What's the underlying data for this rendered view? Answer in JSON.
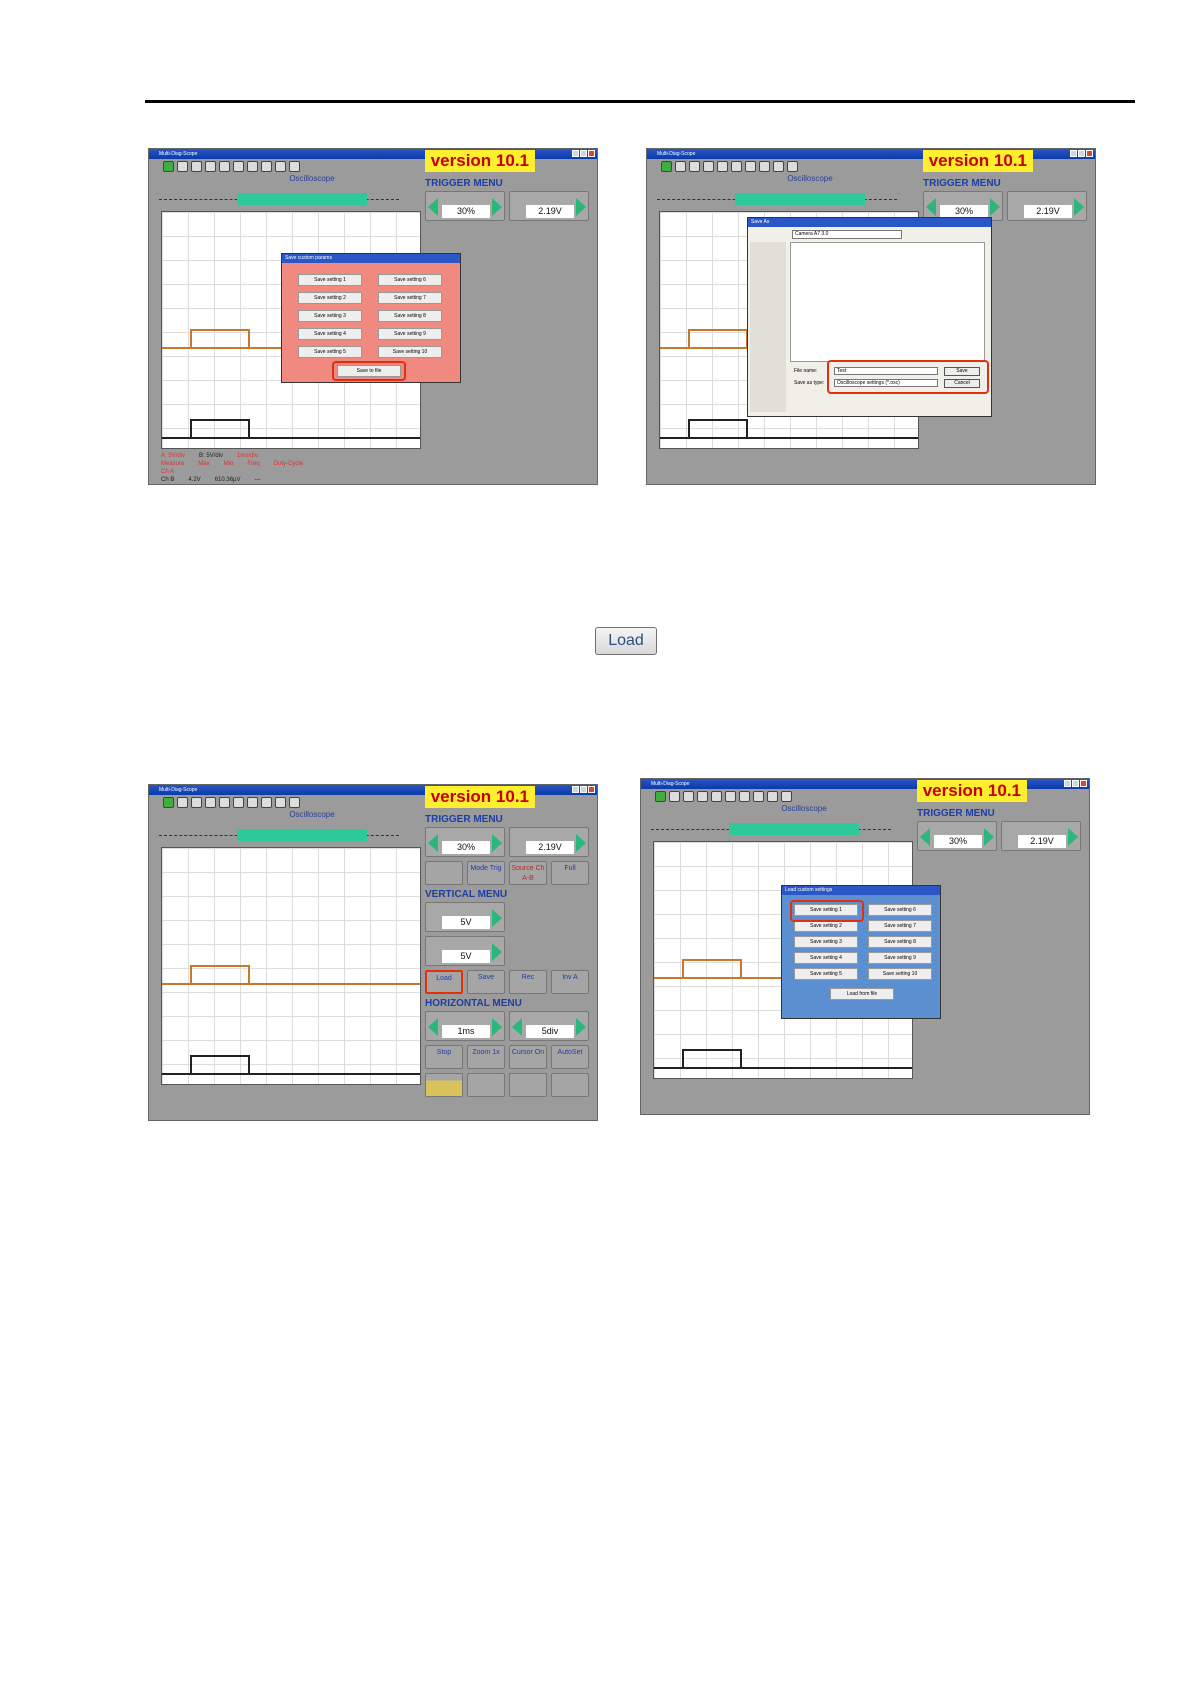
{
  "shots": [
    {
      "app_title": "Multi-Diag-Scope",
      "version": "version 10.1",
      "osc_title": "Oscilloscope",
      "trigger_menu": "TRIGGER MENU",
      "trigger_pos": "30%",
      "trigger_level": "2.19V",
      "dialog_title": "Save custom params",
      "settings_left": [
        "Save setting 1",
        "Save setting 2",
        "Save setting 3",
        "Save setting 4",
        "Save setting 5"
      ],
      "settings_right": [
        "Save setting 6",
        "Save setting 7",
        "Save setting 8",
        "Save setting 9",
        "Save setting 10"
      ],
      "action": "Save to file"
    },
    {
      "app_title": "Multi-Diag-Scope",
      "version": "version 10.1",
      "osc_title": "Oscilloscope",
      "trigger_menu": "TRIGGER MENU",
      "trigger_pos": "30%",
      "trigger_level": "2.19V",
      "dialog_title": "Save As",
      "save_in": "Camera A7 3.0",
      "file_name_label": "File name:",
      "file_name": "Test",
      "file_type_label": "Save as type:",
      "file_type": "Oscilloscope settings (*.osc)",
      "save_button": "Save",
      "cancel_button": "Cancel"
    },
    {
      "app_title": "Multi-Diag-Scope",
      "version": "version 10.1",
      "osc_title": "Oscilloscope",
      "trigger_menu": "TRIGGER MENU",
      "vertical_menu": "VERTICAL MENU",
      "horizontal_menu": "HORIZONTAL MENU",
      "trigger_pos": "30%",
      "trigger_level": "2.19V",
      "cha_scale": "5V",
      "chb_scale": "5V",
      "time_scale": "1ms",
      "window_pos": "5div",
      "load": "Load",
      "save": "Save",
      "rec": "Rec",
      "inv": "Inv A"
    },
    {
      "app_title": "Multi-Diag-Scope",
      "version": "version 10.1",
      "osc_title": "Oscilloscope",
      "trigger_menu": "TRIGGER MENU",
      "trigger_pos": "30%",
      "trigger_level": "2.19V",
      "dialog_title": "Load custom settings",
      "settings_left": [
        "Save setting 1",
        "Save setting 2",
        "Save setting 3",
        "Save setting 4",
        "Save setting 5"
      ],
      "settings_right": [
        "Save setting 6",
        "Save setting 7",
        "Save setting 8",
        "Save setting 9",
        "Save setting 10"
      ],
      "action": "Load from file"
    }
  ],
  "load_icon": "Load",
  "common": {
    "mode": "Mode Trig",
    "source": "Source Ch A-B",
    "full": "Full",
    "stop": "Stop",
    "zoom": "Zoom 1x",
    "cursor": "Cursor On",
    "autoset": "AutoSet",
    "ch_a_scale_label": "A: 5V/div",
    "ch_b_scale_label": "B: 5V/div",
    "time_label": "1ms/div",
    "measure_header": "Measure",
    "max_header": "Max",
    "min_header": "Min",
    "freq_header": "Freq",
    "duty_header": "Duty-Cycle",
    "ch_a": "Ch A",
    "ch_b": "Ch B",
    "ch_b_max": "4.2V",
    "ch_b_min": "610.36µV",
    "ch_b_duty": "---"
  }
}
